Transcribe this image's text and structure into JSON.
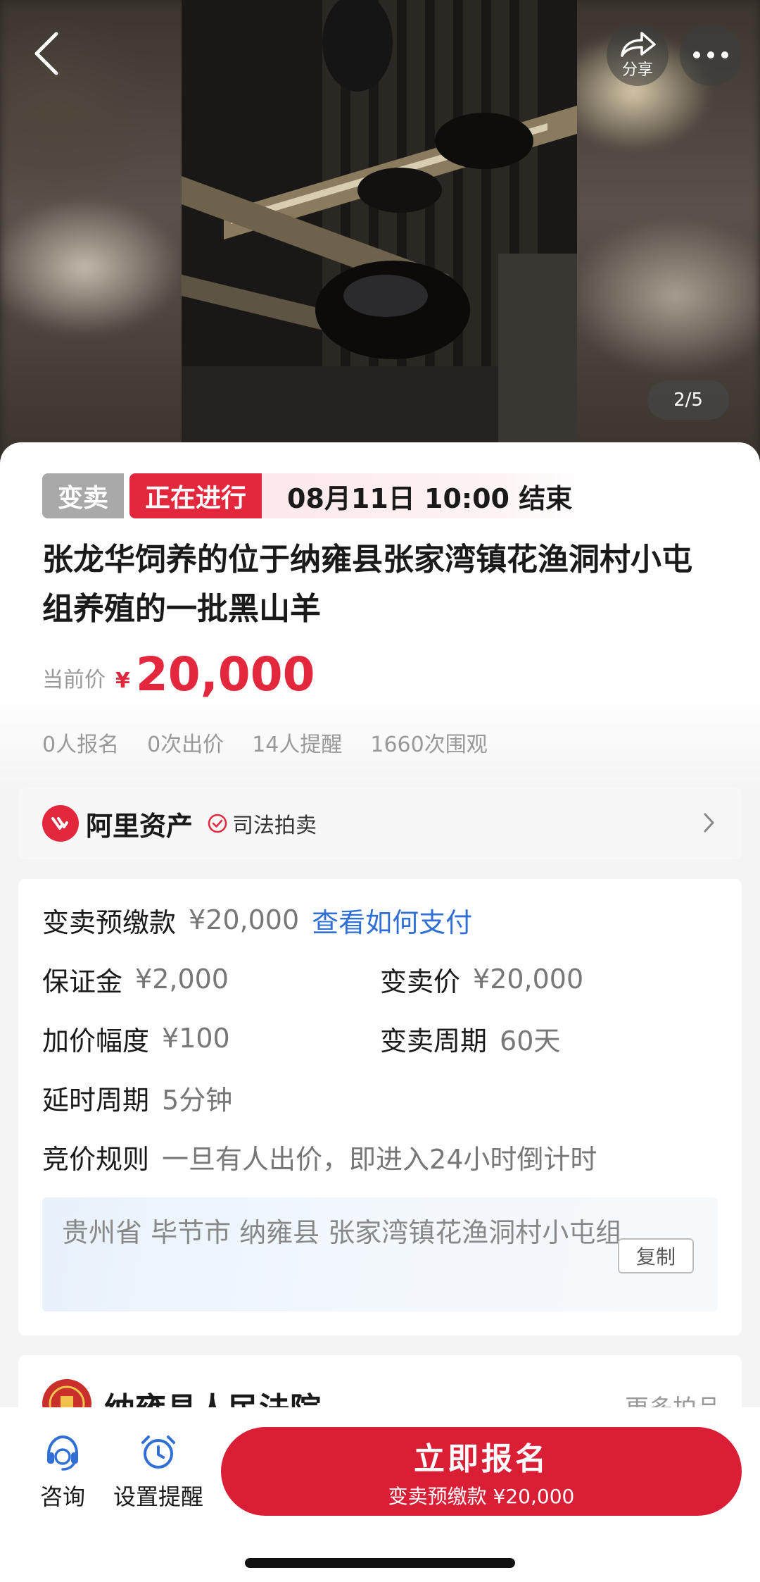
{
  "nav": {
    "share_label": "分享"
  },
  "gallery": {
    "counter": "2/5"
  },
  "status": {
    "type_badge": "变卖",
    "state_badge": "正在进行",
    "end_time": "08月11日 10:00 结束"
  },
  "item": {
    "title": "张龙华饲养的位于纳雍县张家湾镇花渔洞村小屯组养殖的一批黑山羊"
  },
  "price": {
    "label": "当前价",
    "currency": "¥",
    "value": "20,000"
  },
  "stats": {
    "signups": "0人报名",
    "bids": "0次出价",
    "reminders": "14人提醒",
    "views": "1660次围观"
  },
  "platform": {
    "name": "阿里资产",
    "tag": "司法拍卖"
  },
  "info": {
    "prepay_label": "变卖预缴款",
    "prepay_value": "¥20,000",
    "prepay_link": "查看如何支付",
    "deposit_label": "保证金",
    "deposit_value": "¥2,000",
    "sale_price_label": "变卖价",
    "sale_price_value": "¥20,000",
    "increment_label": "加价幅度",
    "increment_value": "¥100",
    "period_label": "变卖周期",
    "period_value": "60天",
    "delay_label": "延时周期",
    "delay_value": "5分钟",
    "rule_label": "竞价规则",
    "rule_value": "一旦有人出价，即进入24小时倒计时",
    "address": "贵州省 毕节市 纳雍县 张家湾镇花渔洞村小屯组",
    "copy_label": "复制"
  },
  "court": {
    "name": "纳雍县人民法院",
    "more_label": "更多拍品"
  },
  "bottom": {
    "consult_label": "咨询",
    "remind_label": "设置提醒",
    "cta_main": "立即报名",
    "cta_sub": "变卖预缴款 ¥20,000"
  }
}
